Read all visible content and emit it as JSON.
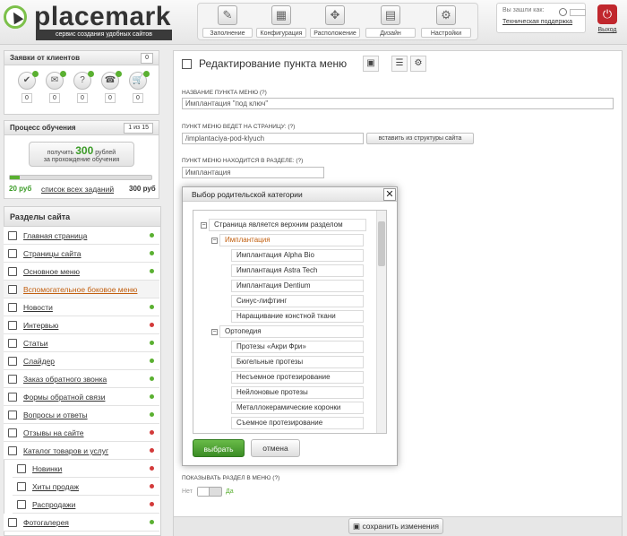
{
  "colors": {
    "accent_green": "#5ab031",
    "dot_red": "#d33a3a",
    "active_orange": "#c25f0f",
    "exit_red": "#c0272d"
  },
  "header": {
    "logo_text": "placemark",
    "logo_sub": "сервис создания удобных сайтов",
    "nav": [
      {
        "label": "Заполнение",
        "icon": "pencil-icon"
      },
      {
        "label": "Конфигурация",
        "icon": "config-icon"
      },
      {
        "label": "Расположение",
        "icon": "layout-icon"
      },
      {
        "label": "Дизайн",
        "icon": "design-icon"
      },
      {
        "label": "Настройки",
        "icon": "gear-icon"
      }
    ],
    "user": {
      "logged_as": "Вы зашли как:",
      "support": "Техническая поддержка"
    },
    "exit_label": "Выход"
  },
  "requests": {
    "title": "Заявки от клиентов",
    "count": "0",
    "items": [
      {
        "icon": "check-icon",
        "count": "0"
      },
      {
        "icon": "chat-icon",
        "count": "0"
      },
      {
        "icon": "question-icon",
        "count": "0"
      },
      {
        "icon": "phone-icon",
        "count": "0"
      },
      {
        "icon": "cart-icon",
        "count": "0"
      }
    ]
  },
  "training": {
    "title": "Процесс обучения",
    "step": "1 из 15",
    "btn_line1": "получить",
    "btn_amount": "300",
    "btn_line1b": "рублей",
    "btn_line2": "за прохождение обучения",
    "progress": 0.07,
    "left_value": "20 руб",
    "link": "список всех заданий",
    "right_value": "300 руб"
  },
  "sections": {
    "title": "Разделы сайта",
    "items": [
      {
        "label": "Главная страница",
        "status": "green"
      },
      {
        "label": "Страницы сайта",
        "status": "green"
      },
      {
        "label": "Основное меню",
        "status": "green"
      },
      {
        "label": "Вспомогательное боковое меню",
        "status": "none"
      },
      {
        "label": "Новости",
        "status": "green"
      },
      {
        "label": "Интервью",
        "status": "red"
      },
      {
        "label": "Статьи",
        "status": "green"
      },
      {
        "label": "Слайдер",
        "status": "green"
      },
      {
        "label": "Заказ обратного звонка",
        "status": "green"
      },
      {
        "label": "Формы обратной связи",
        "status": "green"
      },
      {
        "label": "Вопросы и ответы",
        "status": "green"
      },
      {
        "label": "Отзывы на сайте",
        "status": "red"
      },
      {
        "label": "Каталог товаров и услуг",
        "status": "red"
      },
      {
        "label": "Новинки",
        "status": "red"
      },
      {
        "label": "Хиты продаж",
        "status": "red"
      },
      {
        "label": "Распродажи",
        "status": "red"
      },
      {
        "label": "Фотогалерея",
        "status": "green"
      }
    ]
  },
  "main": {
    "title": "Редактирование пункта меню",
    "name_label": "Название пункта меню (?)",
    "name_value": "Имплантация \"под ключ\"",
    "page_label": "Пункт меню ведет на страницу: (?)",
    "page_value": "/implantaciya-pod-klyuch",
    "page_btn": "вставить из структуры сайта",
    "section_label": "Пункт меню находится в разделе: (?)",
    "section_value": "Имплантация",
    "show_label": "Показывать раздел в меню (?)",
    "toggle_no": "Нет",
    "toggle_yes": "Да",
    "save": "сохранить изменения"
  },
  "modal": {
    "title": "Выбор родительской категории",
    "root": "Страница является верхним разделом",
    "groups": [
      {
        "label": "Имплантация",
        "active": true,
        "children": [
          "Имплантация Alpha Bio",
          "Имплантация Astra Tech",
          "Имплантация Dentium",
          "Синус-лифтинг",
          "Наращивание констной ткани"
        ]
      },
      {
        "label": "Ортопедия",
        "active": false,
        "children": [
          "Протезы «Акри Фри»",
          "Бюгельные протезы",
          "Несъемное протезирование",
          "Нейлоновые протезы",
          "Металлокерамические коронки",
          "Съемное протезирование"
        ]
      }
    ],
    "ok": "выбрать",
    "cancel": "отмена"
  }
}
